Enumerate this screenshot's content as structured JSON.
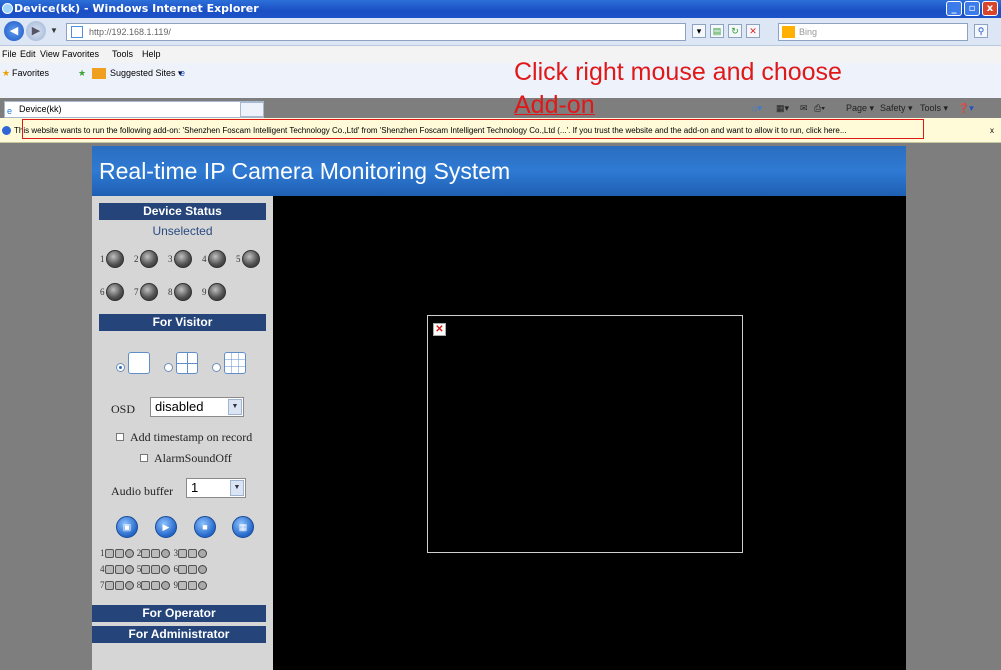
{
  "window": {
    "title": "Device(kk) - Windows Internet Explorer",
    "controls": [
      "_",
      "▫",
      "x"
    ]
  },
  "address_bar": {
    "url": "http://192.168.1.119/",
    "search_placeholder": "Bing"
  },
  "menu": [
    "File",
    "Edit",
    "View",
    "Favorites",
    "Tools",
    "Help"
  ],
  "favorites_bar": {
    "favorites_label": "Favorites",
    "suggested_label": "Suggested Sites ▾"
  },
  "tab": {
    "label": "Device(kk)"
  },
  "command_bar": [
    "Page ▾",
    "Safety ▾",
    "Tools ▾"
  ],
  "info_bar": {
    "message": "This website wants to run the following add-on: 'Shenzhen Foscam Intelligent Technology Co.,Ltd' from 'Shenzhen Foscam Intelligent Technology Co.,Ltd (...'. If you trust the website and the add-on and want to allow it to run, click here...",
    "close": "x"
  },
  "annotation": {
    "line1": "Click right mouse and choose",
    "line2": "Add-on",
    "color": "#e01818"
  },
  "page": {
    "banner_title": "Real-time IP Camera Monitoring System",
    "device_status": {
      "header": "Device Status",
      "status": "Unselected",
      "devices": [
        "1",
        "2",
        "3",
        "4",
        "5",
        "6",
        "7",
        "8",
        "9"
      ]
    },
    "for_visitor": {
      "header": "For Visitor",
      "osd_label": "OSD",
      "osd_value": "disabled",
      "timestamp_label": "Add timestamp on record",
      "alarm_label": "AlarmSoundOff",
      "audio_buffer_label": "Audio buffer",
      "audio_buffer_value": "1"
    },
    "ptz_rows": [
      "1",
      "2",
      "3",
      "4",
      "5",
      "6",
      "7",
      "8",
      "9"
    ],
    "for_operator": "For Operator",
    "for_administrator": "For Administrator"
  },
  "colors": {
    "banner": "#2b6ec0",
    "section_header": "#24447a",
    "info_bar": "#fffbd9",
    "video_bg": "#000000"
  }
}
